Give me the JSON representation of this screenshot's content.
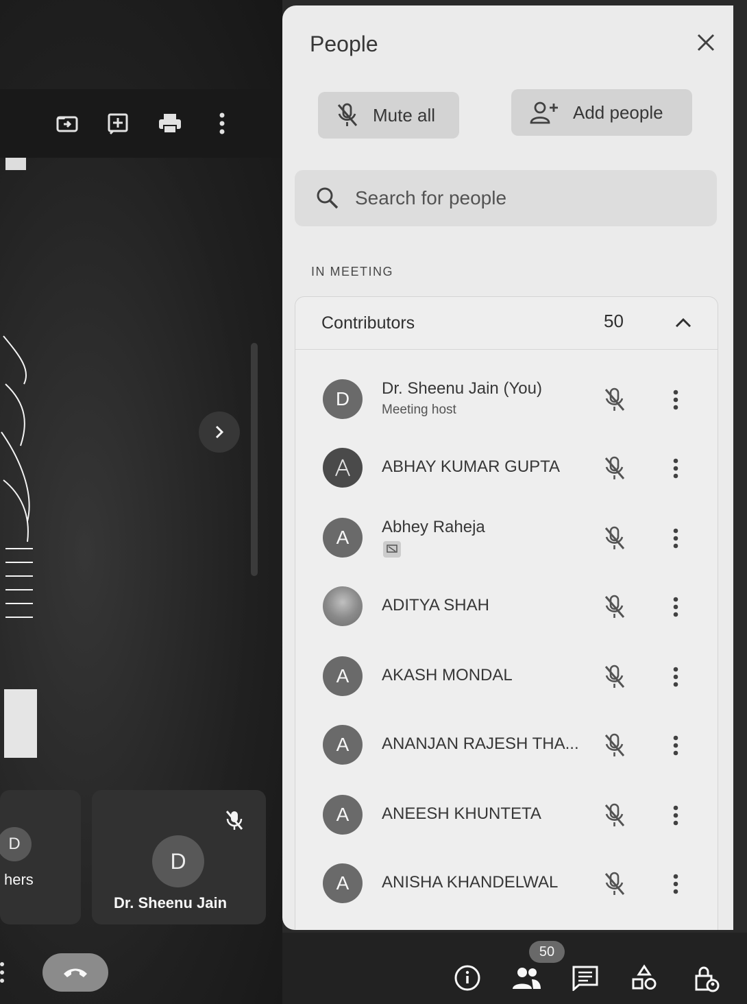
{
  "panel": {
    "title": "People",
    "close_icon": "close-icon",
    "mute_all_label": "Mute all",
    "add_people_label": "Add people",
    "search_placeholder": "Search for people",
    "section_label": "IN MEETING",
    "group": {
      "title": "Contributors",
      "count": "50"
    },
    "people": [
      {
        "name": "Dr. Sheenu Jain (You)",
        "subtitle": "Meeting host",
        "initial": "D"
      },
      {
        "name": "ABHAY KUMAR GUPTA",
        "subtitle": "",
        "initial": "A"
      },
      {
        "name": "Abhey Raheja",
        "subtitle": "",
        "initial": "A"
      },
      {
        "name": "ADITYA SHAH",
        "subtitle": "",
        "initial": ""
      },
      {
        "name": "AKASH MONDAL",
        "subtitle": "",
        "initial": "A"
      },
      {
        "name": "ANANJAN RAJESH THA...",
        "subtitle": "",
        "initial": "A"
      },
      {
        "name": "ANEESH KHUNTETA",
        "subtitle": "",
        "initial": "A"
      },
      {
        "name": "ANISHA KHANDELWAL",
        "subtitle": "",
        "initial": "A"
      }
    ]
  },
  "stage": {
    "tile_partial_initial": "D",
    "tile_partial_name": "hers",
    "tile_main_initial": "D",
    "tile_main_name": "Dr. Sheenu Jain"
  },
  "bottom_bar": {
    "participant_count": "50"
  }
}
